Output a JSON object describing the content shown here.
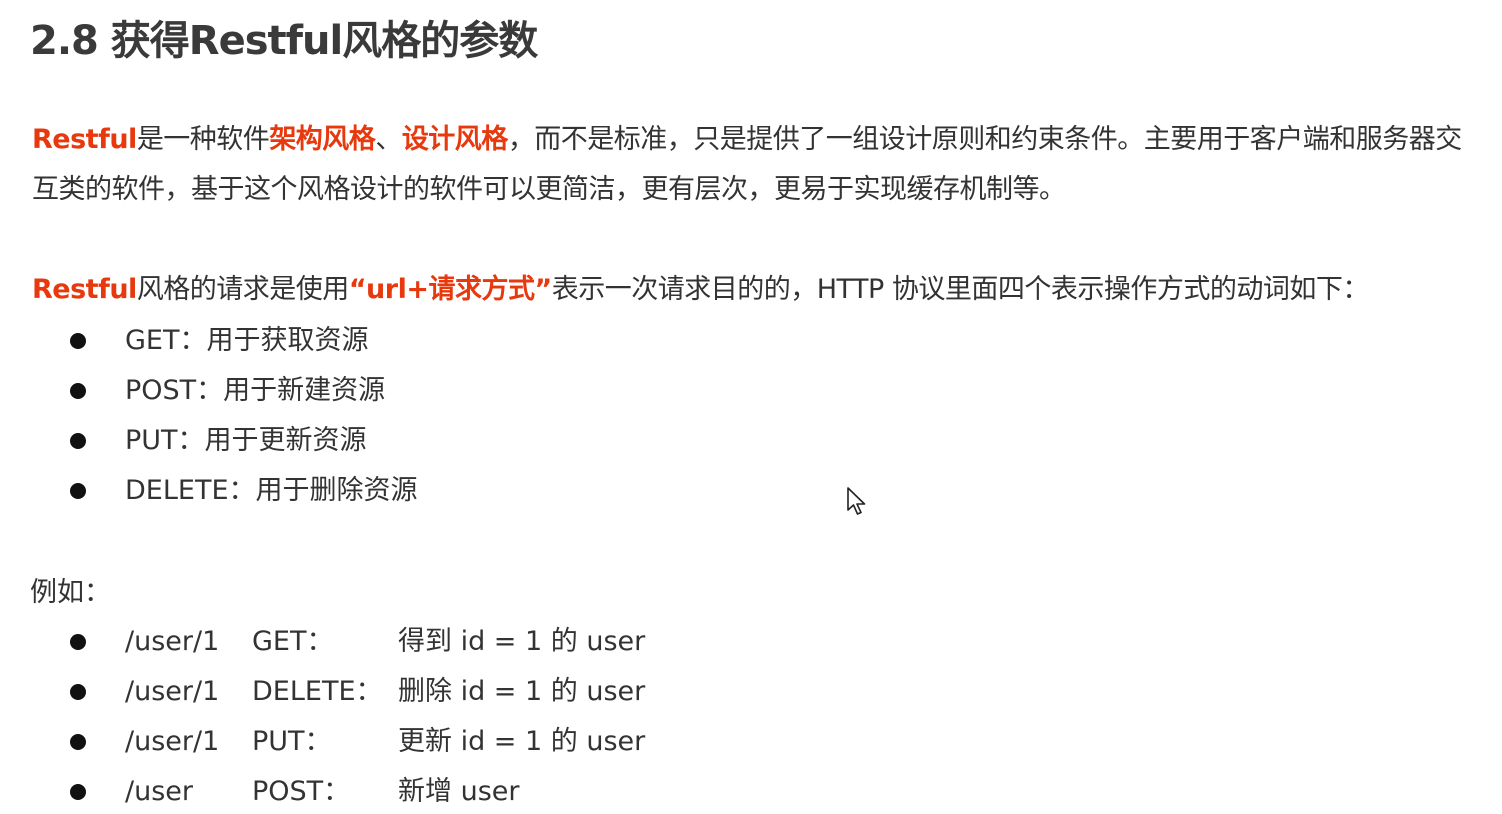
{
  "title": "2.8 获得Restful风格的参数",
  "intro": {
    "part1_hl": "Restful",
    "part2": "是一种软件",
    "part3_hl": "架构风格",
    "part4": "、",
    "part5_hl": "设计风格",
    "part6": "，而不是标准，只是提供了一组设计原则和约束条件。主要用于客户端和服务器交互类的软件，基于这个风格设计的软件可以更简洁，更有层次，更易于实现缓存机制等。"
  },
  "restful_line": {
    "part1_hl": "Restful",
    "part2": "风格的请求是使用",
    "part3_hl": "“url+请求方式”",
    "part4": "表示一次请求目的的，HTTP 协议里面四个表示操作方式的动词如下："
  },
  "methods": [
    "GET：用于获取资源",
    "POST：用于新建资源",
    "PUT：用于更新资源",
    "DELETE：用于删除资源"
  ],
  "example_label": "例如：",
  "examples": [
    {
      "url": "/user/1",
      "method": "GET：",
      "desc": "得到 id = 1 的 user"
    },
    {
      "url": "/user/1",
      "method": "DELETE：",
      "desc": "删除 id = 1 的 user"
    },
    {
      "url": "/user/1",
      "method": "PUT：",
      "desc": "更新 id = 1 的 user"
    },
    {
      "url": "/user",
      "method": "POST：",
      "desc": "新增 user"
    }
  ],
  "colors": {
    "highlight": "#e8380d",
    "text": "#333333",
    "title": "#3a3a3a"
  },
  "icons": {
    "cursor": "mouse-pointer-icon",
    "bullet": "bullet-dot-icon"
  }
}
